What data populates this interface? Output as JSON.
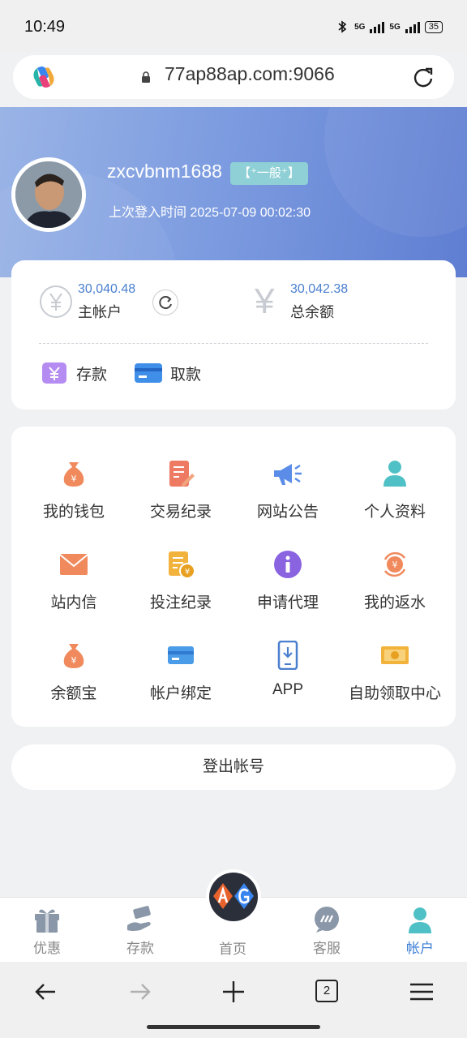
{
  "status_bar": {
    "time": "10:49",
    "network_1": "5G",
    "network_2": "5G",
    "battery": "35"
  },
  "browser": {
    "url": "77ap88ap.com:9066"
  },
  "profile": {
    "username": "zxcvbnm1688",
    "vip_level": "【⁺一般⁺】",
    "last_login_label": "上次登入时间",
    "last_login_time": "2025-07-09 00:02:30"
  },
  "balance": {
    "main_amount": "30,040.48",
    "main_label": "主帐户",
    "total_symbol": "¥",
    "total_amount": "30,042.38",
    "total_label": "总余额",
    "deposit_label": "存款",
    "withdraw_label": "取款"
  },
  "menu": {
    "items": [
      {
        "label": "我的钱包",
        "icon": "money-bag-icon",
        "color": "#f08a5d"
      },
      {
        "label": "交易纪录",
        "icon": "document-edit-icon",
        "color": "#ef7a63"
      },
      {
        "label": "网站公告",
        "icon": "megaphone-icon",
        "color": "#5b8de8"
      },
      {
        "label": "个人资料",
        "icon": "user-icon",
        "color": "#4fc1c6"
      },
      {
        "label": "站内信",
        "icon": "envelope-icon",
        "color": "#f08a5d"
      },
      {
        "label": "投注纪录",
        "icon": "bet-record-icon",
        "color": "#f2b33d"
      },
      {
        "label": "申请代理",
        "icon": "info-icon",
        "color": "#8a63e0"
      },
      {
        "label": "我的返水",
        "icon": "rebate-icon",
        "color": "#f08a5d"
      },
      {
        "label": "余额宝",
        "icon": "money-bag-icon",
        "color": "#f08a5d"
      },
      {
        "label": "帐户绑定",
        "icon": "card-icon",
        "color": "#4a9ce8"
      },
      {
        "label": "APP",
        "icon": "phone-download-icon",
        "color": "#4a7fcf"
      },
      {
        "label": "自助领取中心",
        "icon": "cash-icon",
        "color": "#f2b33d"
      }
    ]
  },
  "logout_label": "登出帐号",
  "tabbar": {
    "items": [
      {
        "label": "优惠",
        "icon": "gift-icon"
      },
      {
        "label": "存款",
        "icon": "deposit-hand-icon"
      },
      {
        "label": "首页",
        "icon": "ag-logo"
      },
      {
        "label": "客服",
        "icon": "chat-icon"
      },
      {
        "label": "帐户",
        "icon": "account-icon",
        "active": true
      }
    ]
  },
  "browser_nav": {
    "tab_count": "2"
  },
  "colors": {
    "accent": "#3d7fd8",
    "amount": "#4a7fcf",
    "banner_start": "#9ab4e6",
    "banner_end": "#5f7ed2"
  }
}
